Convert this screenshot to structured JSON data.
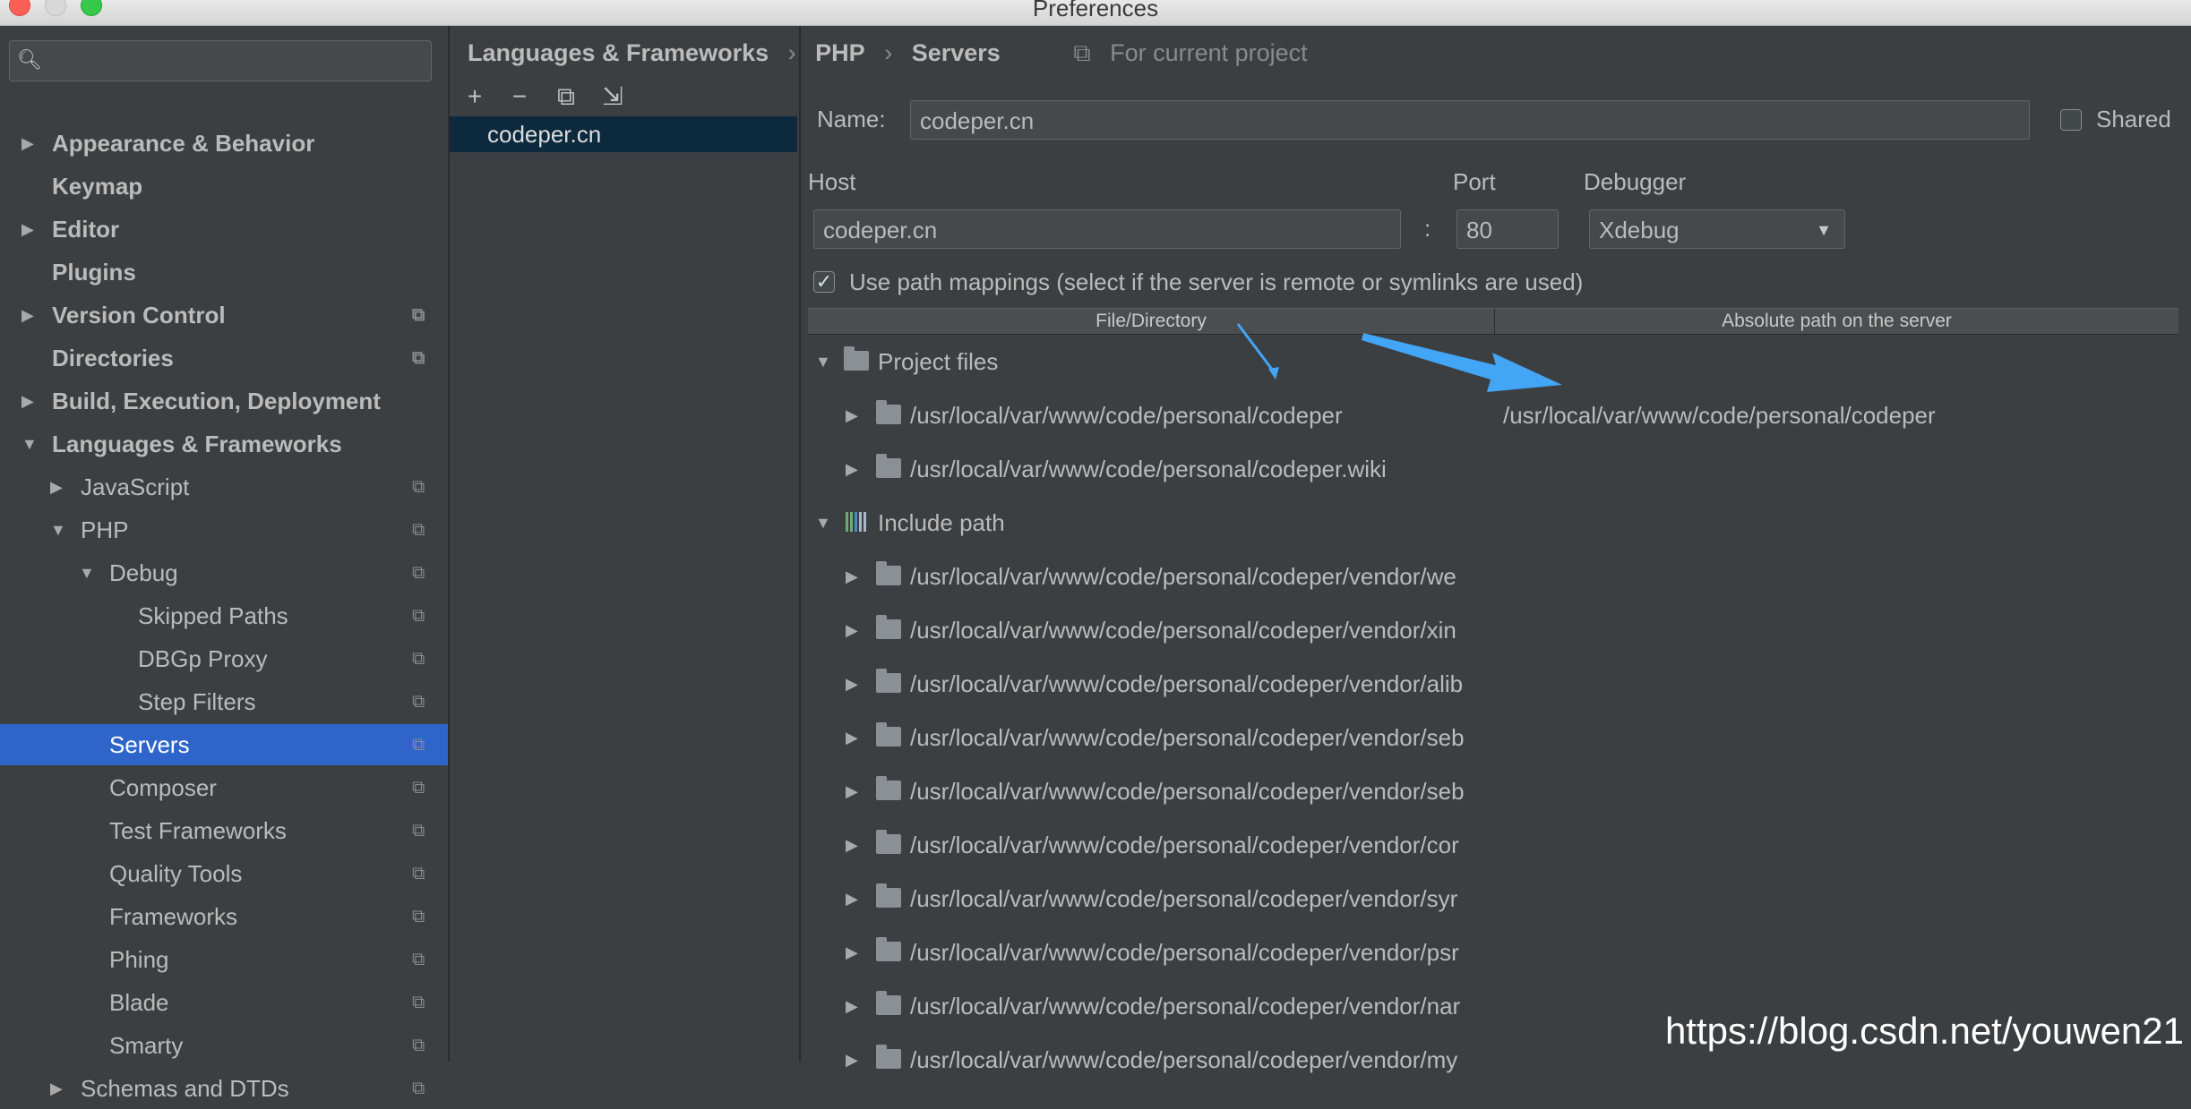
{
  "window": {
    "title": "Preferences"
  },
  "sidebar": {
    "search_placeholder": "",
    "items": [
      {
        "label": "Appearance & Behavior",
        "bold": true,
        "arrow": "right",
        "level": 0,
        "copy": false
      },
      {
        "label": "Keymap",
        "bold": true,
        "arrow": "",
        "level": 0,
        "copy": false
      },
      {
        "label": "Editor",
        "bold": true,
        "arrow": "right",
        "level": 0,
        "copy": false
      },
      {
        "label": "Plugins",
        "bold": true,
        "arrow": "",
        "level": 0,
        "copy": false
      },
      {
        "label": "Version Control",
        "bold": true,
        "arrow": "right",
        "level": 0,
        "copy": true
      },
      {
        "label": "Directories",
        "bold": true,
        "arrow": "",
        "level": 0,
        "copy": true
      },
      {
        "label": "Build, Execution, Deployment",
        "bold": true,
        "arrow": "right",
        "level": 0,
        "copy": false
      },
      {
        "label": "Languages & Frameworks",
        "bold": true,
        "arrow": "down",
        "level": 0,
        "copy": false
      },
      {
        "label": "JavaScript",
        "bold": false,
        "arrow": "right",
        "level": 1,
        "copy": true
      },
      {
        "label": "PHP",
        "bold": false,
        "arrow": "down",
        "level": 1,
        "copy": true
      },
      {
        "label": "Debug",
        "bold": false,
        "arrow": "down",
        "level": 2,
        "copy": true
      },
      {
        "label": "Skipped Paths",
        "bold": false,
        "arrow": "",
        "level": 3,
        "copy": true
      },
      {
        "label": "DBGp Proxy",
        "bold": false,
        "arrow": "",
        "level": 3,
        "copy": true
      },
      {
        "label": "Step Filters",
        "bold": false,
        "arrow": "",
        "level": 3,
        "copy": true
      },
      {
        "label": "Servers",
        "bold": false,
        "arrow": "",
        "level": 2,
        "copy": true,
        "selected": true
      },
      {
        "label": "Composer",
        "bold": false,
        "arrow": "",
        "level": 2,
        "copy": true
      },
      {
        "label": "Test Frameworks",
        "bold": false,
        "arrow": "",
        "level": 2,
        "copy": true
      },
      {
        "label": "Quality Tools",
        "bold": false,
        "arrow": "",
        "level": 2,
        "copy": true
      },
      {
        "label": "Frameworks",
        "bold": false,
        "arrow": "",
        "level": 2,
        "copy": true
      },
      {
        "label": "Phing",
        "bold": false,
        "arrow": "",
        "level": 2,
        "copy": true
      },
      {
        "label": "Blade",
        "bold": false,
        "arrow": "",
        "level": 2,
        "copy": true
      },
      {
        "label": "Smarty",
        "bold": false,
        "arrow": "",
        "level": 2,
        "copy": true
      },
      {
        "label": "Schemas and DTDs",
        "bold": false,
        "arrow": "right",
        "level": 1,
        "copy": true
      }
    ]
  },
  "breadcrumb": {
    "parts": [
      "Languages & Frameworks",
      "PHP",
      "Servers"
    ],
    "separator": "›",
    "scope": "For current project"
  },
  "servers": {
    "toolbar": [
      "+",
      "−",
      "⧉",
      "⇲"
    ],
    "list": [
      "codeper.cn"
    ]
  },
  "form": {
    "name_label": "Name:",
    "name_value": "codeper.cn",
    "shared_label": "Shared",
    "host_label": "Host",
    "host_value": "codeper.cn",
    "colon": ":",
    "port_label": "Port",
    "port_value": "80",
    "debugger_label": "Debugger",
    "debugger_value": "Xdebug",
    "mappings_label": "Use path mappings (select if the server is remote or symlinks are used)",
    "mappings_checked": true
  },
  "mappings": {
    "col1": "File/Directory",
    "col2": "Absolute path on the server",
    "project_group": "Project files",
    "project_rows": [
      {
        "local": "/usr/local/var/www/code/personal/codeper",
        "server": "/usr/local/var/www/code/personal/codeper"
      },
      {
        "local": "/usr/local/var/www/code/personal/codeper.wiki",
        "server": ""
      }
    ],
    "include_group": "Include path",
    "include_rows": [
      "/usr/local/var/www/code/personal/codeper/vendor/we",
      "/usr/local/var/www/code/personal/codeper/vendor/xin",
      "/usr/local/var/www/code/personal/codeper/vendor/alib",
      "/usr/local/var/www/code/personal/codeper/vendor/seb",
      "/usr/local/var/www/code/personal/codeper/vendor/seb",
      "/usr/local/var/www/code/personal/codeper/vendor/cor",
      "/usr/local/var/www/code/personal/codeper/vendor/syr",
      "/usr/local/var/www/code/personal/codeper/vendor/psr",
      "/usr/local/var/www/code/personal/codeper/vendor/nar",
      "/usr/local/var/www/code/personal/codeper/vendor/my"
    ]
  },
  "watermark": "https://blog.csdn.net/youwen21",
  "colors": {
    "selection": "#2f65ca",
    "server_row": "#0d293e",
    "annotation_arrow": "#42a5f5"
  }
}
